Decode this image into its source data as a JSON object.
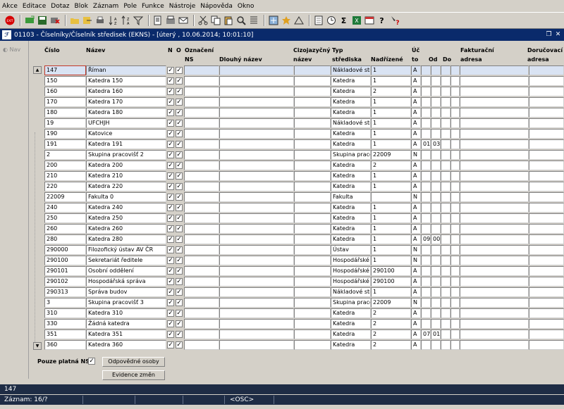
{
  "menu": [
    "Akce",
    "Editace",
    "Dotaz",
    "Blok",
    "Záznam",
    "Pole",
    "Funkce",
    "Nástroje",
    "Nápověda",
    "Okno"
  ],
  "window": {
    "title": "01103 - Číselníky/Číselník středisek (EKNS) - [úterý  , 10.06.2014; 10:01:10]"
  },
  "nav": {
    "label": "Nav"
  },
  "headers": {
    "cislo": "Číslo",
    "nazev": "Název",
    "n": "N",
    "o": "O",
    "ozn": "Označení\nNS",
    "dlouhy": "Dlouhý název",
    "cizi": "Cizojazyčný\nnázev",
    "typ": "Typ\nstřediska",
    "nadr": "Nadřízené",
    "ucto": "Úč\nto",
    "od": "Od",
    "do": "Do",
    "fakt": "Fakturační\nadresa",
    "dor": "Doručovací\nadresa"
  },
  "rows": [
    {
      "cislo": "147",
      "nazev": "Říman",
      "typ": "Nákladové stř",
      "nadr": "1",
      "ucto": "A",
      "od": "",
      "do": ""
    },
    {
      "cislo": "150",
      "nazev": "Katedra 150",
      "typ": "Katedra",
      "nadr": "1",
      "ucto": "A",
      "od": "",
      "do": ""
    },
    {
      "cislo": "160",
      "nazev": "Katedra 160",
      "typ": "Katedra",
      "nadr": "2",
      "ucto": "A",
      "od": "",
      "do": ""
    },
    {
      "cislo": "170",
      "nazev": "Katedra 170",
      "typ": "Katedra",
      "nadr": "1",
      "ucto": "A",
      "od": "",
      "do": ""
    },
    {
      "cislo": "180",
      "nazev": "Katedra 180",
      "typ": "Katedra",
      "nadr": "1",
      "ucto": "A",
      "od": "",
      "do": ""
    },
    {
      "cislo": "19",
      "nazev": "UFCHJH",
      "typ": "Nákladové stř",
      "nadr": "1",
      "ucto": "A",
      "od": "",
      "do": ""
    },
    {
      "cislo": "190",
      "nazev": "Katovice",
      "typ": "Katedra",
      "nadr": "1",
      "ucto": "A",
      "od": "",
      "do": ""
    },
    {
      "cislo": "191",
      "nazev": "Katedra 191",
      "typ": "Katedra",
      "nadr": "1",
      "ucto": "A",
      "od": "01",
      "do": "03"
    },
    {
      "cislo": "2",
      "nazev": "Skupina pracovišť 2",
      "typ": "Skupina pracc",
      "nadr": "22009",
      "ucto": "N",
      "od": "",
      "do": ""
    },
    {
      "cislo": "200",
      "nazev": "Katedra 200",
      "typ": "Katedra",
      "nadr": "2",
      "ucto": "A",
      "od": "",
      "do": ""
    },
    {
      "cislo": "210",
      "nazev": "Katedra 210",
      "typ": "Katedra",
      "nadr": "1",
      "ucto": "A",
      "od": "",
      "do": ""
    },
    {
      "cislo": "220",
      "nazev": "Katedra 220",
      "typ": "Katedra",
      "nadr": "1",
      "ucto": "A",
      "od": "",
      "do": ""
    },
    {
      "cislo": "22009",
      "nazev": "Fakulta 0",
      "typ": "Fakulta",
      "nadr": "",
      "ucto": "N",
      "od": "",
      "do": ""
    },
    {
      "cislo": "240",
      "nazev": "Katedra 240",
      "typ": "Katedra",
      "nadr": "1",
      "ucto": "A",
      "od": "",
      "do": ""
    },
    {
      "cislo": "250",
      "nazev": "Katedra 250",
      "typ": "Katedra",
      "nadr": "1",
      "ucto": "A",
      "od": "",
      "do": ""
    },
    {
      "cislo": "260",
      "nazev": "Katedra 260",
      "typ": "Katedra",
      "nadr": "1",
      "ucto": "A",
      "od": "",
      "do": ""
    },
    {
      "cislo": "280",
      "nazev": "Katedra 280",
      "typ": "Katedra",
      "nadr": "1",
      "ucto": "A",
      "od": "09",
      "do": "00"
    },
    {
      "cislo": "290000",
      "nazev": "Filozofický ústav AV ČR",
      "typ": "Ústav",
      "nadr": "1",
      "ucto": "N",
      "od": "",
      "do": ""
    },
    {
      "cislo": "290100",
      "nazev": "Sekretariát ředitele",
      "typ": "Hospodářské",
      "nadr": "1",
      "ucto": "N",
      "od": "",
      "do": ""
    },
    {
      "cislo": "290101",
      "nazev": "Osobní oddělení",
      "typ": "Hospodářské",
      "nadr": "290100",
      "ucto": "A",
      "od": "",
      "do": ""
    },
    {
      "cislo": "290102",
      "nazev": "Hospodářská správa",
      "typ": "Hospodářské",
      "nadr": "290100",
      "ucto": "A",
      "od": "",
      "do": ""
    },
    {
      "cislo": "290313",
      "nazev": "Správa budov",
      "typ": "Nákladové stř",
      "nadr": "1",
      "ucto": "A",
      "od": "",
      "do": ""
    },
    {
      "cislo": "3",
      "nazev": "Skupina pracovišť 3",
      "typ": "Skupina pracc",
      "nadr": "22009",
      "ucto": "N",
      "od": "",
      "do": ""
    },
    {
      "cislo": "310",
      "nazev": "Katedra 310",
      "typ": "Katedra",
      "nadr": "2",
      "ucto": "A",
      "od": "",
      "do": ""
    },
    {
      "cislo": "330",
      "nazev": "Žádná katedra",
      "typ": "Katedra",
      "nadr": "2",
      "ucto": "A",
      "od": "",
      "do": ""
    },
    {
      "cislo": "351",
      "nazev": "Katedra 351",
      "typ": "Katedra",
      "nadr": "2",
      "ucto": "A",
      "od": "07",
      "do": "01"
    },
    {
      "cislo": "360",
      "nazev": "Katedra 360",
      "typ": "Katedra",
      "nadr": "2",
      "ucto": "A",
      "od": "",
      "do": ""
    }
  ],
  "footer": {
    "only_valid_label": "Pouze platná NS",
    "only_valid_checked": true,
    "btn_responsible": "Odpovědné osoby",
    "btn_changes": "Evidence změn"
  },
  "message": "147",
  "status": {
    "record": "Záznam: 16/?",
    "osc": "<OSC>"
  },
  "icons": [
    "exit-icon",
    "new-record-icon",
    "save-icon",
    "delete-icon",
    "folder-icon",
    "export-icon",
    "print-icon",
    "sort-icon",
    "filter-icon",
    "print-preview-icon",
    "attach-icon",
    "mail-icon",
    "cut-icon",
    "copy-icon",
    "paste-icon",
    "search-icon",
    "binoculars-icon",
    "settings-icon",
    "star-icon",
    "triangle-icon",
    "calculator-icon",
    "time-icon",
    "sigma-icon",
    "excel-icon",
    "calendar-icon",
    "help-icon",
    "question-icon"
  ]
}
